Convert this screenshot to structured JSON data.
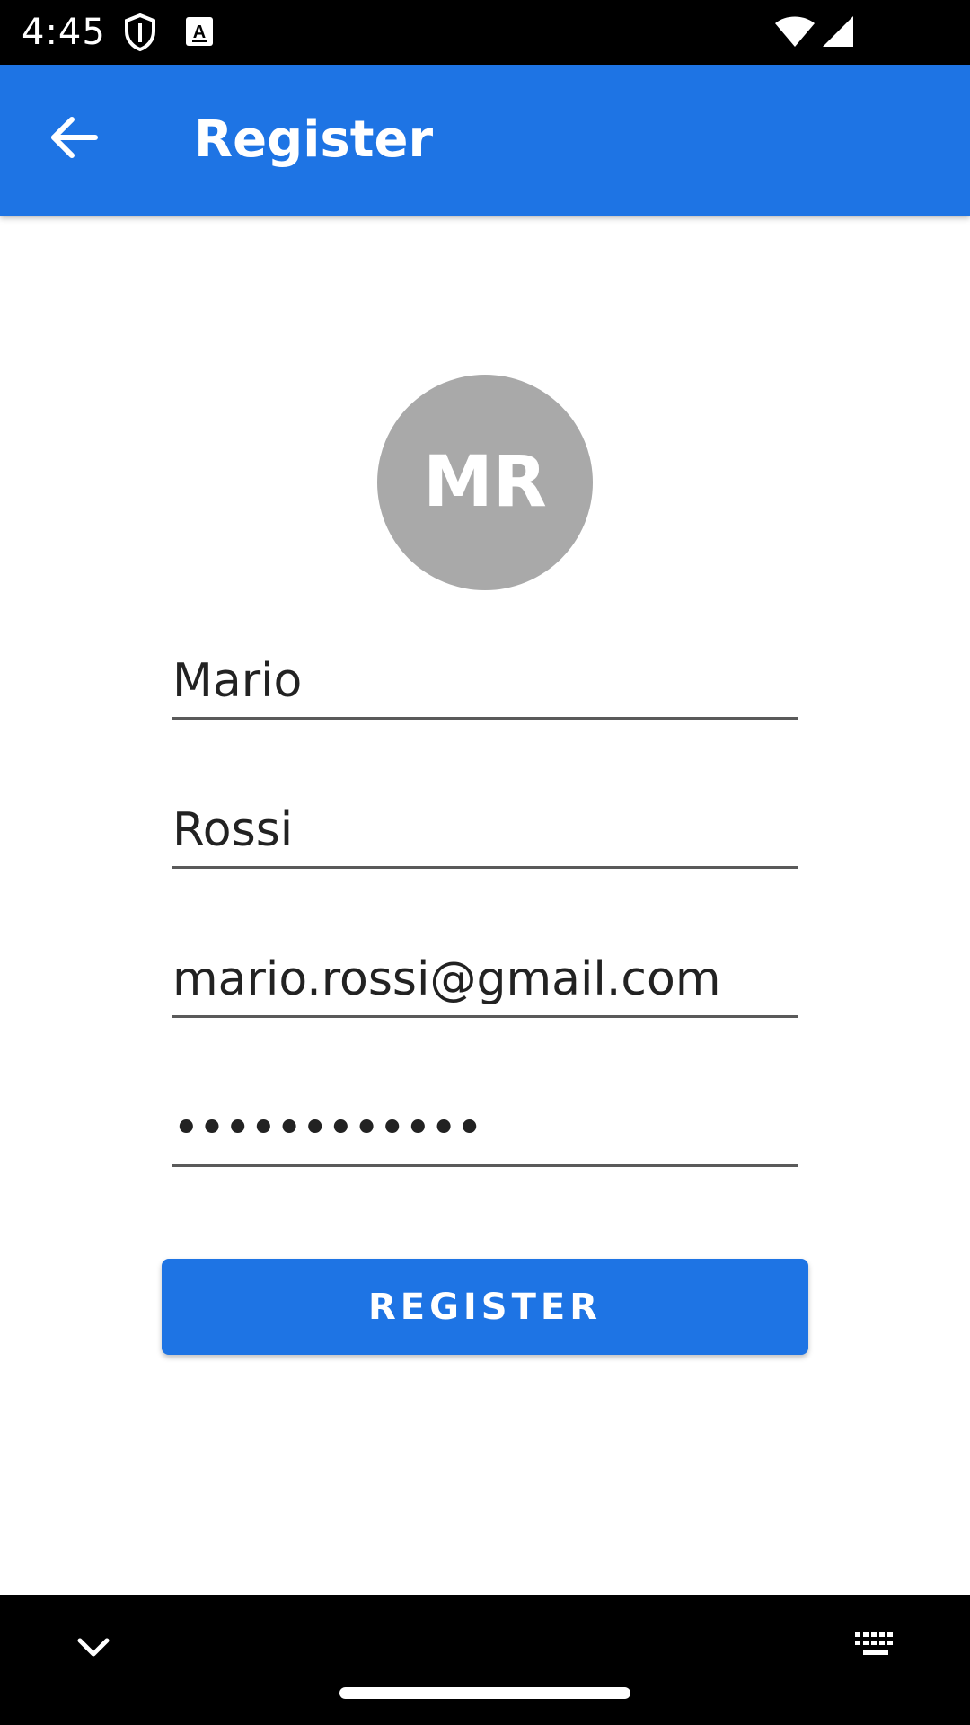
{
  "status_bar": {
    "time": "4:45",
    "icons": [
      "shield-icon",
      "font-a-icon",
      "wifi-icon",
      "cellular-signal-icon"
    ]
  },
  "app_bar": {
    "title": "Register",
    "back_icon": "arrow-left-icon",
    "background_color": "#1e74e4"
  },
  "avatar": {
    "initials": "MR",
    "color": "#a9a9a9"
  },
  "form": {
    "first_name": {
      "value": "Mario"
    },
    "last_name": {
      "value": "Rossi"
    },
    "email": {
      "value": "mario.rossi@gmail.com"
    },
    "password": {
      "value": "••••••••••••"
    }
  },
  "register_button": {
    "label": "REGISTER",
    "color": "#1e74e4"
  },
  "nav_bar": {
    "icons": [
      "chevron-down-icon",
      "keyboard-icon"
    ]
  }
}
